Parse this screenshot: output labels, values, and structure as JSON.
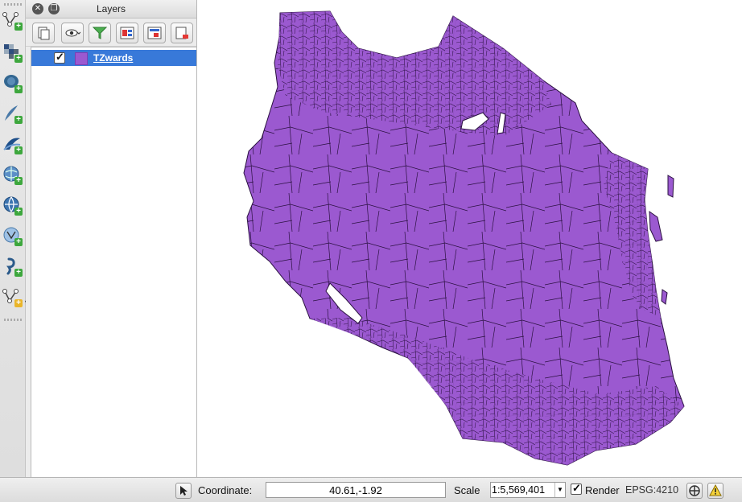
{
  "layers_panel": {
    "title": "Layers",
    "tools": [
      "open-layer-styling-icon",
      "manage-visibility-icon",
      "filter-legend-icon",
      "expand-all-icon",
      "collapse-all-icon",
      "remove-layer-icon"
    ],
    "layers": [
      {
        "name": "TZwards",
        "checked": true,
        "color": "#9b59d0",
        "selected": true
      }
    ]
  },
  "toolbar": {
    "buttons": [
      "add-vector-layer-icon",
      "add-raster-layer-icon",
      "add-postgis-layer-icon",
      "add-spatialite-layer-icon",
      "add-mssql-layer-icon",
      "add-wms-layer-icon",
      "add-wcs-layer-icon",
      "add-wfs-layer-icon",
      "add-delimited-text-layer-icon",
      "new-shapefile-layer-icon"
    ]
  },
  "map": {
    "fill_color": "#9b59d0",
    "stroke_color": "#2a1040",
    "background": "#ffffff"
  },
  "statusbar": {
    "coordinate_label": "Coordinate:",
    "coordinate_value": "40.61,-1.92",
    "scale_label": "Scale",
    "scale_value": "1:5,569,401",
    "render_label": "Render",
    "render_checked": true,
    "crs_label": "EPSG:4210"
  }
}
